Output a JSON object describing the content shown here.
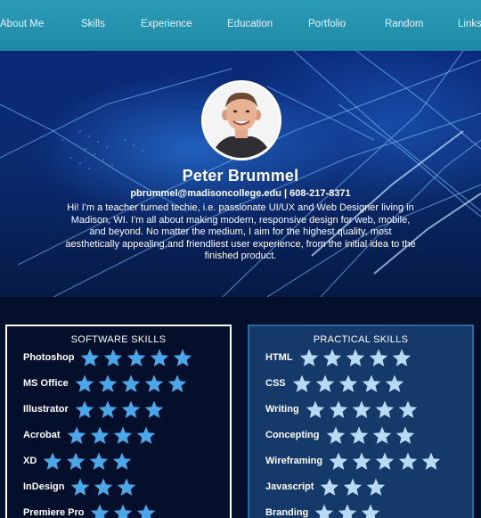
{
  "nav": {
    "items": [
      "About Me",
      "Skills",
      "Experience",
      "Education",
      "Portfolio",
      "Random",
      "Links"
    ]
  },
  "profile": {
    "name": "Peter Brummel",
    "contact": "pbrummel@madisoncollege.edu | 608-217-8371",
    "bio": "Hi! I'm a teacher turned techie, i.e. passionate UI/UX and Web Designer living in Madison, WI. I'm all about making modern, responsive design for web, mobile, and beyond. No matter the medium, I aim for the highest quality, most aesthetically appealing,and friendliest user experience, from the initial idea to the finished product."
  },
  "software_skills": {
    "title": "SOFTWARE SKILLS",
    "items": [
      {
        "label": "Photoshop",
        "stars": 5
      },
      {
        "label": "MS Office",
        "stars": 5
      },
      {
        "label": "Illustrator",
        "stars": 4
      },
      {
        "label": "Acrobat",
        "stars": 4
      },
      {
        "label": "XD",
        "stars": 4
      },
      {
        "label": "InDesign",
        "stars": 3
      },
      {
        "label": "Premiere Pro",
        "stars": 3
      }
    ]
  },
  "practical_skills": {
    "title": "PRACTICAL SKILLS",
    "items": [
      {
        "label": "HTML",
        "stars": 5
      },
      {
        "label": "CSS",
        "stars": 5
      },
      {
        "label": "Writing",
        "stars": 5
      },
      {
        "label": "Concepting",
        "stars": 4
      },
      {
        "label": "Wireframing",
        "stars": 5
      },
      {
        "label": "Javascript",
        "stars": 3
      },
      {
        "label": "Branding",
        "stars": 3
      }
    ]
  },
  "colors": {
    "nav": "#2b9bb7",
    "star_software": "#4aa8ea",
    "star_practical": "#b8daf5",
    "panel_practical": "#153a6a"
  }
}
